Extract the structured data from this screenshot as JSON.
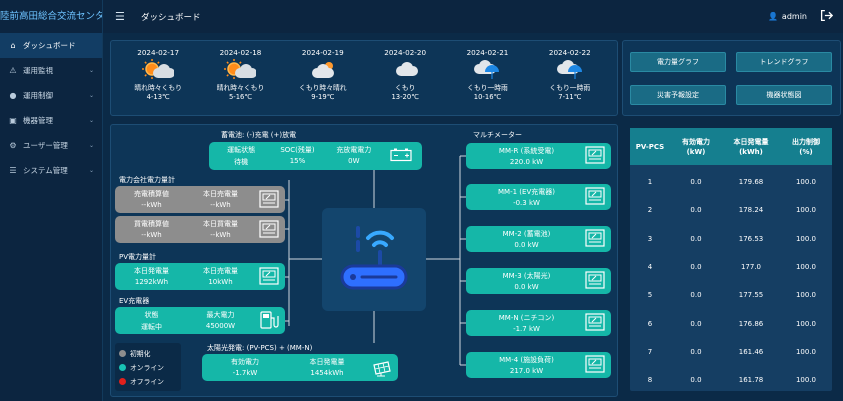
{
  "app": {
    "title": "陸前高田総合交流センター",
    "page_title": "ダッシュボード",
    "user": "admin"
  },
  "sidebar": {
    "items": [
      {
        "label": "ダッシュボード",
        "icon": "dashboard-icon",
        "active": true
      },
      {
        "label": "運用監視",
        "icon": "warning-icon"
      },
      {
        "label": "運用制御",
        "icon": "location-icon"
      },
      {
        "label": "機器管理",
        "icon": "folder-icon"
      },
      {
        "label": "ユーザー管理",
        "icon": "gear-icon"
      },
      {
        "label": "システム管理",
        "icon": "document-icon"
      }
    ]
  },
  "weather": [
    {
      "date": "2024-02-17",
      "text": "晴れ時々くもり",
      "temp": "4-13℃",
      "icon": "sun-cloud-icon"
    },
    {
      "date": "2024-02-18",
      "text": "晴れ時々くもり",
      "temp": "5-16℃",
      "icon": "sun-cloud-icon"
    },
    {
      "date": "2024-02-19",
      "text": "くもり時々晴れ",
      "temp": "9-19℃",
      "icon": "cloud-sun-icon"
    },
    {
      "date": "2024-02-20",
      "text": "くもり",
      "temp": "13-20℃",
      "icon": "cloud-icon"
    },
    {
      "date": "2024-02-21",
      "text": "くもり一時雨",
      "temp": "10-16℃",
      "icon": "cloud-umbrella-icon"
    },
    {
      "date": "2024-02-22",
      "text": "くもり一時雨",
      "temp": "7-11℃",
      "icon": "cloud-umbrella-icon"
    }
  ],
  "quick_buttons": [
    "電力量グラフ",
    "トレンドグラフ",
    "災害予報設定",
    "機器状態図"
  ],
  "battery": {
    "title": "蓄電池: (-)充電 (+)放電",
    "headers": [
      "運転状態",
      "SOC(残量)",
      "充放電電力"
    ],
    "values": [
      "待機",
      "15%",
      "0W"
    ]
  },
  "utility_meter": {
    "title": "電力会社電力量計",
    "sell": {
      "headers": [
        "売電積算値",
        "本日売電量"
      ],
      "values": [
        "--kWh",
        "--kWh"
      ]
    },
    "buy": {
      "headers": [
        "買電積算値",
        "本日買電量"
      ],
      "values": [
        "--kWh",
        "--kWh"
      ]
    }
  },
  "pv_meter": {
    "title": "PV電力量計",
    "headers": [
      "本日発電量",
      "本日売電量"
    ],
    "values": [
      "1292kWh",
      "10kWh"
    ]
  },
  "ev": {
    "title": "EV充電器",
    "headers": [
      "状態",
      "最大電力"
    ],
    "values": [
      "運転中",
      "45000W"
    ]
  },
  "solar": {
    "title": "太陽光発電:  (PV-PCS) + (MM-N)",
    "headers": [
      "有効電力",
      "本日発電量"
    ],
    "values": [
      "-1.7kW",
      "1454kWh"
    ]
  },
  "multimeter": {
    "title": "マルチメーター",
    "items": [
      {
        "name": "MM-R (系統受電)",
        "value": "220.0 kW"
      },
      {
        "name": "MM-1 (EV充電器)",
        "value": "-0.3 kW"
      },
      {
        "name": "MM-2 (蓄電池)",
        "value": "0.0 kW"
      },
      {
        "name": "MM-3 (太陽光)",
        "value": "0.0 kW"
      },
      {
        "name": "MM-N (ニチコン)",
        "value": "-1.7 kW"
      },
      {
        "name": "MM-4 (施設負荷)",
        "value": "217.0 kW"
      }
    ]
  },
  "legend": [
    {
      "label": "初期化",
      "color": "#8d8d8d"
    },
    {
      "label": "オンライン",
      "color": "#18c2b3"
    },
    {
      "label": "オフライン",
      "color": "#e0201c"
    }
  ],
  "pcs_table": {
    "headers": [
      "PV-PCS",
      "有効電力\n(kW)",
      "本日発電量\n(kWh)",
      "出力制御\n(%)"
    ],
    "rows": [
      [
        "1",
        "0.0",
        "179.68",
        "100.0"
      ],
      [
        "2",
        "0.0",
        "178.24",
        "100.0"
      ],
      [
        "3",
        "0.0",
        "176.53",
        "100.0"
      ],
      [
        "4",
        "0.0",
        "177.0",
        "100.0"
      ],
      [
        "5",
        "0.0",
        "177.55",
        "100.0"
      ],
      [
        "6",
        "0.0",
        "176.86",
        "100.0"
      ],
      [
        "7",
        "0.0",
        "161.46",
        "100.0"
      ],
      [
        "8",
        "0.0",
        "161.78",
        "100.0"
      ]
    ]
  }
}
